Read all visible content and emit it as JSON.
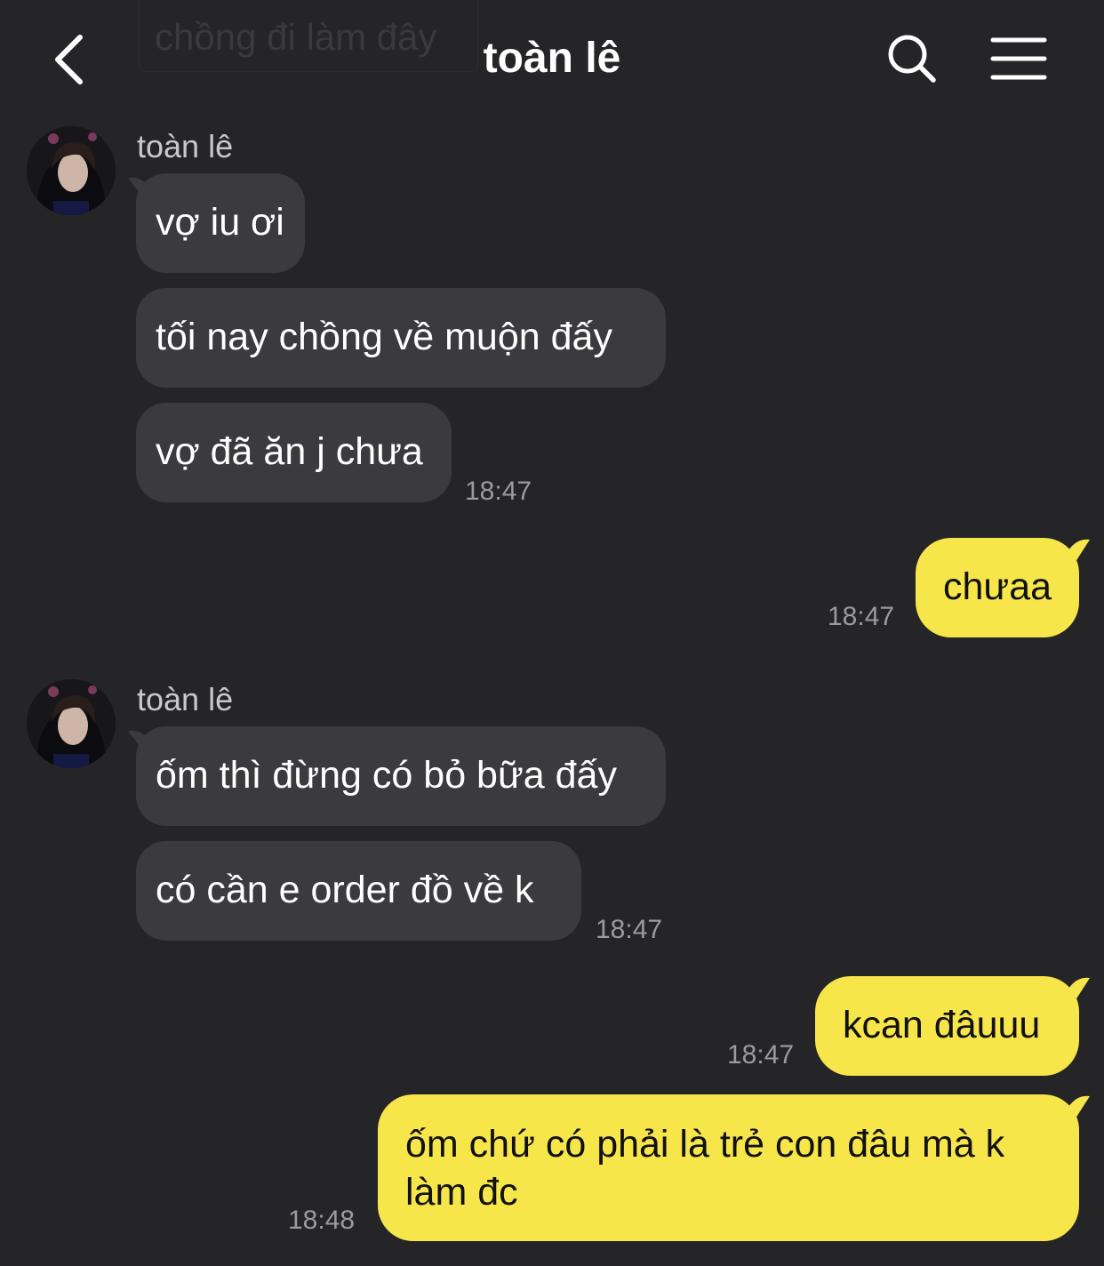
{
  "header": {
    "ghost_text": "chồng đi làm đây",
    "title": "toàn lê",
    "back_icon": "chevron-left-icon",
    "search_icon": "search-icon",
    "menu_icon": "hamburger-menu-icon"
  },
  "colors": {
    "background": "#252527",
    "incoming_bubble": "#3b3b3e",
    "outgoing_bubble": "#f7e64a",
    "timestamp": "#9b9b9f"
  },
  "messages": {
    "group1": {
      "sender": "toàn lê",
      "m1": "vợ iu ơi",
      "m2": "tối nay chồng về muộn đấy",
      "m3": "vợ đã ăn j chưa",
      "time": "18:47"
    },
    "out1": {
      "text": "chưaa",
      "time": "18:47"
    },
    "group2": {
      "sender": "toàn lê",
      "m1": "ốm thì đừng có bỏ bữa đấy",
      "m2": "có cần e order đồ về k",
      "time": "18:47"
    },
    "out2": {
      "text": "kcan đâuuu",
      "time": "18:47"
    },
    "out3": {
      "line1": "ốm chứ có phải là trẻ con đâu mà k",
      "line2": "làm đc",
      "time": "18:48"
    }
  }
}
